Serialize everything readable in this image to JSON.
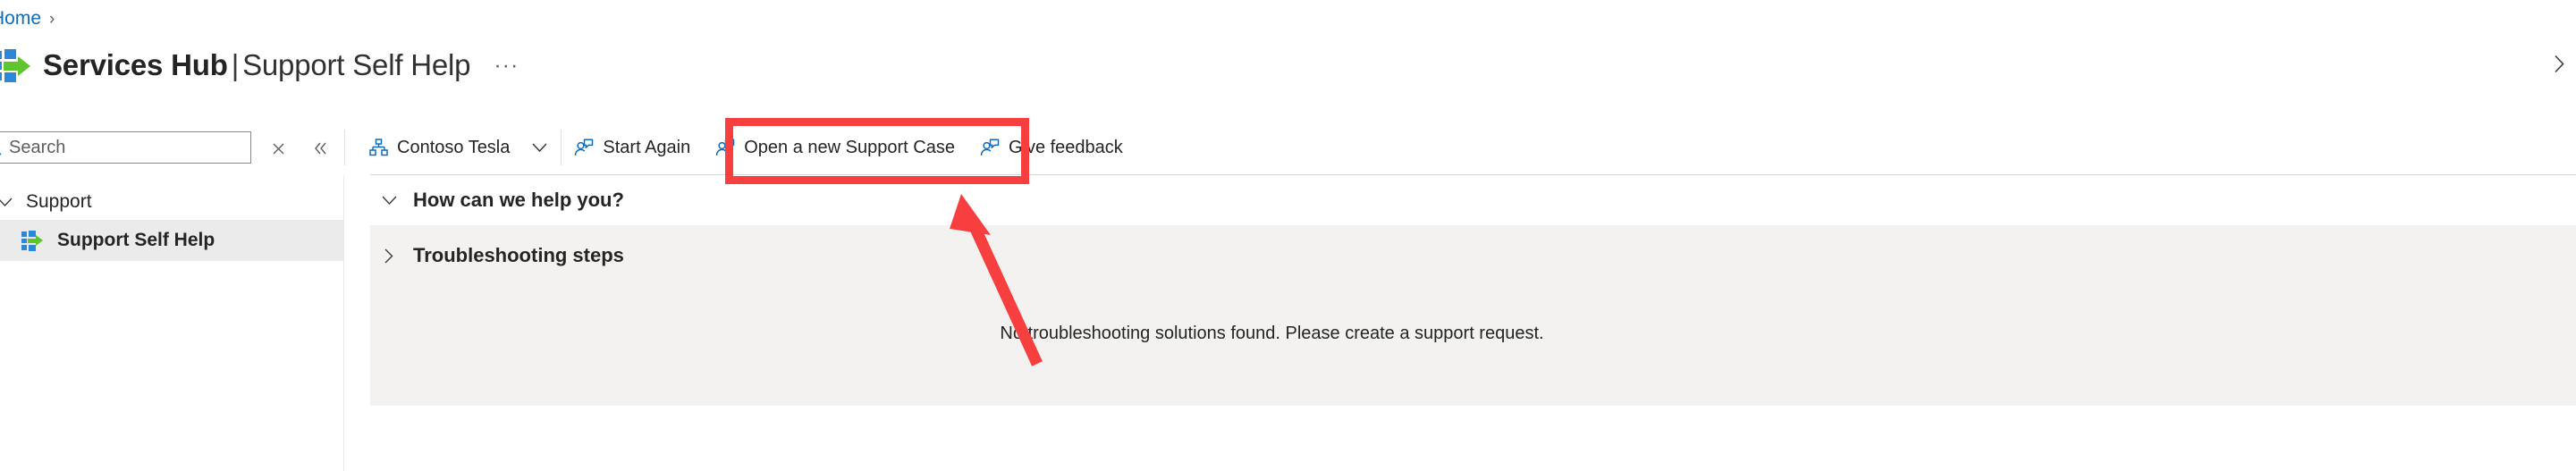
{
  "breadcrumb": {
    "items": [
      {
        "label": "Home",
        "separator": "›"
      }
    ]
  },
  "header": {
    "logo_icon": "services-hub-logo-icon",
    "title_primary": "Services Hub",
    "title_divider": "|",
    "title_secondary": "Support Self Help",
    "overflow_label": "···",
    "collapse_right_icon": "chevron-right-icon"
  },
  "search": {
    "icon": "search-icon",
    "placeholder": "Search",
    "value": "",
    "clear_icon": "close-icon",
    "collapse_icon": "double-chevron-left-icon"
  },
  "command_bar": {
    "buttons": [
      {
        "id": "org-selector",
        "icon": "org-hierarchy-icon",
        "label": "Contoso Tesla",
        "chevron": "chevron-down-icon",
        "has_dropdown": true
      },
      {
        "id": "start-again",
        "icon": "support-person-icon",
        "label": "Start Again",
        "has_dropdown": false
      },
      {
        "id": "open-new-support-case",
        "icon": "support-person-icon",
        "label": "Open a new Support Case",
        "has_dropdown": false,
        "highlighted": true
      },
      {
        "id": "give-feedback",
        "icon": "support-person-icon",
        "label": "Give feedback",
        "has_dropdown": false
      }
    ]
  },
  "sidebar": {
    "group": {
      "chevron": "chevron-down-icon",
      "label": "Support"
    },
    "items": [
      {
        "icon": "services-hub-logo-icon",
        "label": "Support Self Help",
        "selected": true
      }
    ]
  },
  "content": {
    "sections": [
      {
        "id": "how-can-we-help",
        "chevron": "chevron-down-icon",
        "label": "How can we help you?",
        "expanded": true
      },
      {
        "id": "troubleshooting-steps",
        "chevron": "chevron-right-icon",
        "label": "Troubleshooting steps",
        "expanded": false
      }
    ],
    "empty_message": "No troubleshooting solutions found. Please create a support request."
  },
  "annotations": {
    "highlight_color": "#f73f3f",
    "box_target": "open-new-support-case",
    "arrow_target": "open-new-support-case"
  },
  "colors": {
    "link": "#0f6cbd",
    "accent_blue": "#0f6cbd",
    "icon_blue": "#0f6cbd",
    "logo_blue": "#2b88d8",
    "logo_green": "#5fc52e",
    "panel_gray": "#f3f2f1",
    "selected_gray": "#ebebeb",
    "text": "#242424",
    "annotation_red": "#f73f3f"
  }
}
